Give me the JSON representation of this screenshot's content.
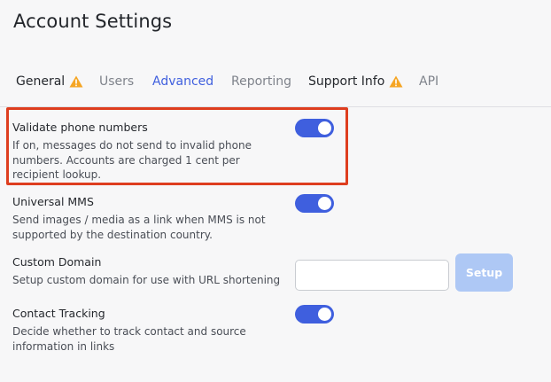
{
  "page": {
    "title": "Account Settings"
  },
  "tabs": [
    {
      "label": "General",
      "warning": true
    },
    {
      "label": "Users",
      "warning": false
    },
    {
      "label": "Advanced",
      "warning": false,
      "active": true
    },
    {
      "label": "Reporting",
      "warning": false
    },
    {
      "label": "Support Info",
      "warning": true
    },
    {
      "label": "API",
      "warning": false
    }
  ],
  "settings": {
    "validate_phone": {
      "title": "Validate phone numbers",
      "desc_lines": [
        "If on, messages do not send to invalid phone",
        "numbers. Accounts are charged 1 cent per",
        "recipient lookup."
      ],
      "enabled": true
    },
    "universal_mms": {
      "title": "Universal MMS",
      "desc_lines": [
        "Send images / media as a link when MMS is not",
        "supported by the destination country."
      ],
      "enabled": true
    },
    "custom_domain": {
      "title": "Custom Domain",
      "desc_lines": [
        "Setup custom domain for use with URL shortening"
      ],
      "input_value": "",
      "button_label": "Setup"
    },
    "contact_tracking": {
      "title": "Contact Tracking",
      "desc_lines": [
        "Decide whether to track contact and source",
        "information in links"
      ],
      "enabled": true
    }
  },
  "colors": {
    "accent": "#3f5fde",
    "warning": "#f5a524",
    "highlight": "#de3e1f",
    "setup_button": "#aec8f5"
  },
  "icons": {
    "warning": "warning-triangle-icon"
  }
}
